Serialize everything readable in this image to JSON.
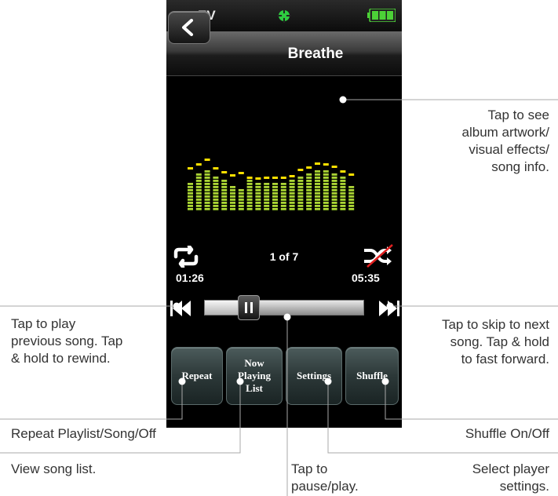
{
  "status": {
    "carrier": "EV"
  },
  "player": {
    "title": "Breathe",
    "track_counter": "1 of 7",
    "elapsed": "01:26",
    "total": "05:35",
    "progress_fraction": 0.27,
    "visualizer_bar_count": 20
  },
  "softkeys": {
    "repeat": "Repeat",
    "now_playing": [
      "Now",
      "Playing",
      "List"
    ],
    "settings": "Settings",
    "shuffle": "Shuffle"
  },
  "callouts": {
    "album": [
      "Tap to see",
      "album artwork/",
      "visual effects/",
      "song info."
    ],
    "next": [
      "Tap to skip to next",
      "song. Tap & hold",
      "to fast forward."
    ],
    "prev": [
      "Tap to play",
      "previous song. Tap",
      "& hold to rewind."
    ],
    "repeat": "Repeat Playlist/Song/Off",
    "shuffle": "Shuffle On/Off",
    "songlist": "View song list.",
    "pause": [
      "Tap to",
      "pause/play."
    ],
    "settings": [
      "Select player",
      "settings."
    ]
  },
  "colors": {
    "accent_green": "#9acd32",
    "peak_yellow": "#ffe000",
    "gps_green": "#2ecc40",
    "battery_green": "#4cd137"
  }
}
